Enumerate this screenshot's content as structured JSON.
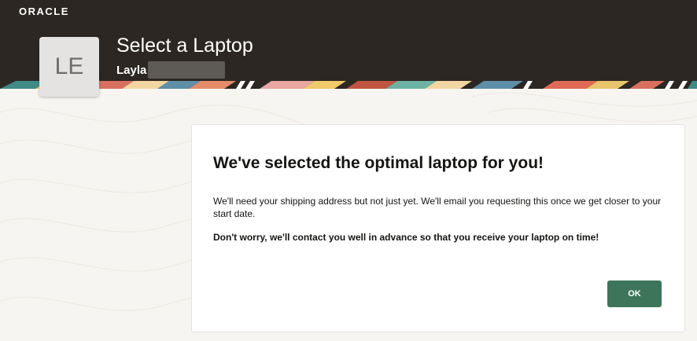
{
  "brand": {
    "logo_text": "ORACLE"
  },
  "header": {
    "avatar_initials": "LE",
    "title": "Select a Laptop",
    "user_name": "Layla"
  },
  "dialog": {
    "title": "We've selected the optimal laptop for you!",
    "message": "We'll need your shipping address but not just yet. We'll email you requesting this once we get closer to your start date.",
    "emphasis": "Don't worry, we'll contact you well in advance so that you receive your laptop on time!",
    "ok_label": "OK"
  },
  "colors": {
    "header_bg": "#2c2722",
    "page_bg": "#f7f5f1",
    "ok_button": "#3c7559"
  }
}
